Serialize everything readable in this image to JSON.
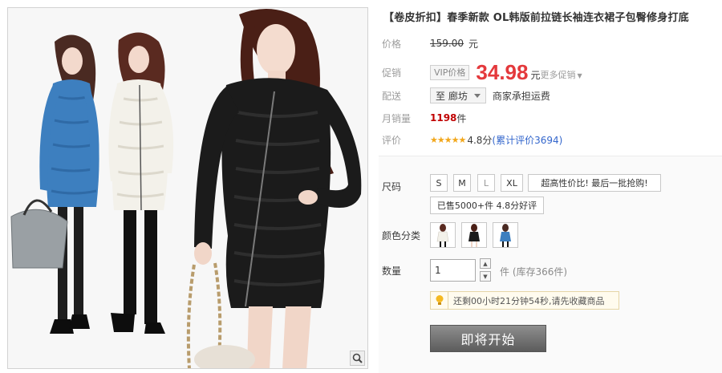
{
  "product": {
    "title": "【卷皮折扣】春季新款 OL韩版前拉链长袖连衣裙子包臀修身打底",
    "image_alt_icon": "product-photo"
  },
  "price": {
    "label": "价格",
    "original": "159.00",
    "unit": "元"
  },
  "promo": {
    "label": "促销",
    "vip_tag": "VIP价格",
    "price": "34.98",
    "unit": "元",
    "more": "更多促销"
  },
  "delivery": {
    "label": "配送",
    "region": "至 廊坊",
    "note": "商家承担运费"
  },
  "monthly_sales": {
    "label": "月销量",
    "value": "1198",
    "unit": "件"
  },
  "rating": {
    "label": "评价",
    "stars": "★★★★★",
    "score": "4.8分",
    "total": "(累计评价3694)"
  },
  "options": {
    "size_label": "尺码",
    "sizes": [
      "S",
      "M",
      "L",
      "XL"
    ],
    "promo_tag_1": "超高性价比! 最后一批抢购!",
    "promo_tag_2": "已售5000+件 4.8分好评",
    "color_label": "颜色分类",
    "colors": [
      "white",
      "black",
      "blue"
    ],
    "quantity_label": "数量",
    "quantity_value": "1",
    "stock": "件 (库存366件)",
    "countdown": "还剩00小时21分钟54秒,请先收藏商品",
    "buy_button": "即将开始"
  },
  "colors": {
    "sale_red": "#e4393c",
    "sold_red": "#c00000",
    "link_blue": "#3366cc",
    "star_gold": "#f2a71b",
    "dress_blue": "#3d7fbf",
    "dress_white": "#f3f1ea",
    "dress_black": "#1b1b1b"
  }
}
